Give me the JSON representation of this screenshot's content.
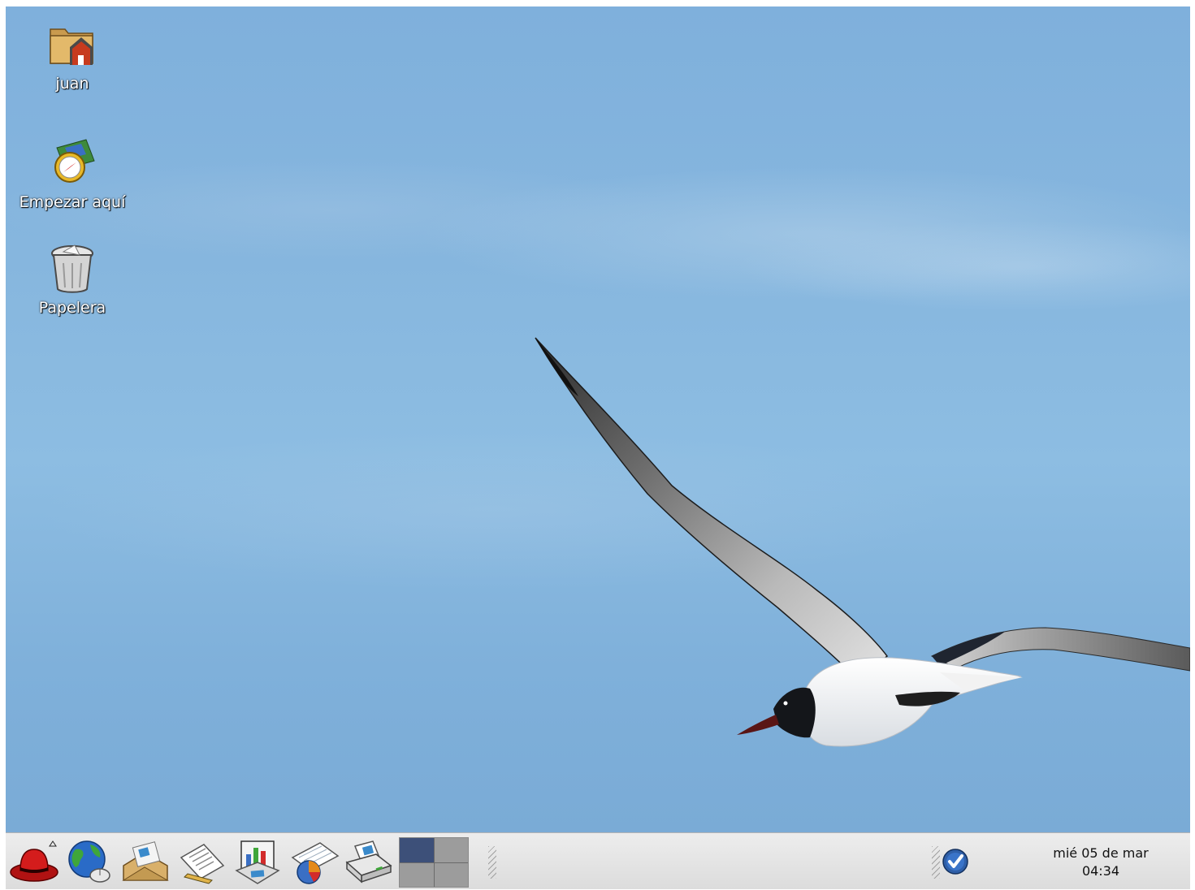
{
  "desktop": {
    "wallpaper": "seagull-in-blue-sky",
    "icons": [
      {
        "label": "juan",
        "icon": "home-folder-icon"
      },
      {
        "label": "Empezar aquí",
        "icon": "start-here-compass-icon"
      },
      {
        "label": "Papelera",
        "icon": "trash-can-icon"
      }
    ]
  },
  "panel": {
    "launchers": [
      {
        "icon": "red-hat-menu-icon"
      },
      {
        "icon": "web-browser-globe-icon"
      },
      {
        "icon": "email-envelope-icon"
      },
      {
        "icon": "text-document-icon"
      },
      {
        "icon": "presentation-icon"
      },
      {
        "icon": "spreadsheet-icon"
      },
      {
        "icon": "printer-icon"
      }
    ],
    "workspaces": {
      "count": 4,
      "active_index": 0
    },
    "notification": {
      "icon": "update-checkmark-icon"
    },
    "clock": {
      "date": "mié 05 de mar",
      "time": "04:34"
    }
  },
  "colors": {
    "sky": "#86b6de",
    "panel_bg": "#e4e4e4",
    "active_workspace": "#3d5079",
    "inactive_workspace": "#9c9c9c"
  }
}
